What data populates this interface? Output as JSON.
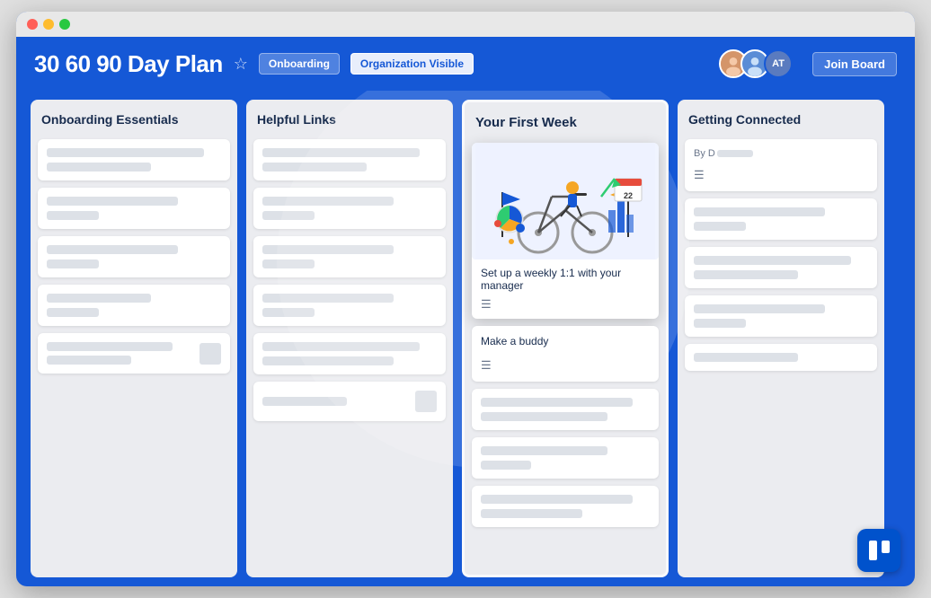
{
  "window": {
    "titlebar": {
      "dots": [
        "red",
        "yellow",
        "green"
      ]
    }
  },
  "header": {
    "title": "30 60 90 Day Plan",
    "star_label": "☆",
    "badge_onboarding": "Onboarding",
    "badge_org_visible": "Organization Visible",
    "avatars": [
      {
        "type": "photo",
        "label": "User 1"
      },
      {
        "type": "photo",
        "label": "User 2"
      },
      {
        "type": "initials",
        "label": "AT"
      }
    ],
    "join_board_label": "Join Board"
  },
  "columns": [
    {
      "id": "col1",
      "title": "Onboarding Essentials",
      "highlighted": false,
      "cards": [
        {
          "type": "skeleton",
          "lines": [
            "full",
            "short"
          ]
        },
        {
          "type": "skeleton",
          "lines": [
            "medium",
            "shorter"
          ]
        },
        {
          "type": "skeleton",
          "lines": [
            "medium",
            "shorter"
          ]
        },
        {
          "type": "skeleton",
          "lines": [
            "short",
            "shorter"
          ]
        },
        {
          "type": "skeleton",
          "lines": [
            "full",
            "short",
            "shorter"
          ]
        }
      ]
    },
    {
      "id": "col2",
      "title": "Helpful Links",
      "highlighted": false,
      "cards": [
        {
          "type": "skeleton",
          "lines": [
            "full",
            "short"
          ]
        },
        {
          "type": "skeleton",
          "lines": [
            "medium",
            "shorter"
          ]
        },
        {
          "type": "skeleton",
          "lines": [
            "medium",
            "shorter"
          ]
        },
        {
          "type": "skeleton",
          "lines": [
            "medium",
            "shorter"
          ]
        },
        {
          "type": "skeleton",
          "lines": [
            "full",
            "medium"
          ]
        },
        {
          "type": "skeleton",
          "lines": [
            "short"
          ]
        }
      ]
    },
    {
      "id": "col3",
      "title": "Your First Week",
      "highlighted": true,
      "cards": [
        {
          "type": "featured",
          "description": "Set up a weekly 1:1 with your manager"
        },
        {
          "type": "make-buddy",
          "title": "Make a buddy"
        },
        {
          "type": "skeleton",
          "lines": [
            "full",
            "medium"
          ]
        },
        {
          "type": "skeleton",
          "lines": [
            "medium",
            "shorter"
          ]
        },
        {
          "type": "skeleton",
          "lines": [
            "full",
            "short"
          ]
        }
      ]
    },
    {
      "id": "col4",
      "title": "Getting Connected",
      "highlighted": false,
      "cards": [
        {
          "type": "by-line",
          "prefix": "By D"
        },
        {
          "type": "skeleton",
          "lines": [
            "medium",
            "shorter"
          ]
        },
        {
          "type": "skeleton",
          "lines": [
            "full",
            "short"
          ]
        },
        {
          "type": "skeleton",
          "lines": [
            "medium",
            "shorter"
          ]
        },
        {
          "type": "skeleton",
          "lines": [
            "short"
          ]
        }
      ]
    }
  ],
  "trello": {
    "logo_label": "Trello"
  }
}
